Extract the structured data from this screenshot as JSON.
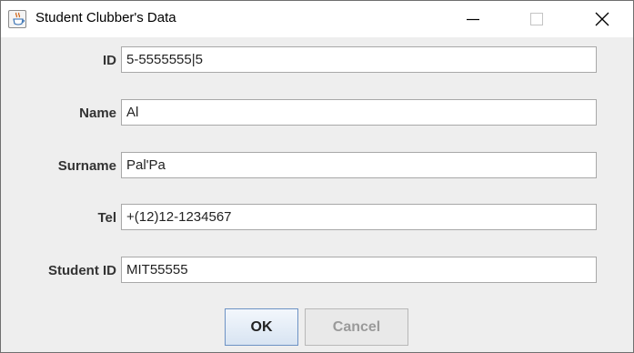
{
  "window": {
    "title": "Student Clubber's Data",
    "icons": {
      "app": "java-coffee-cup-icon",
      "minimize": "minimize-icon",
      "maximize": "maximize-icon",
      "close": "close-icon"
    }
  },
  "form": {
    "fields": [
      {
        "label": "ID",
        "value": "5-5555555|5"
      },
      {
        "label": "Name",
        "value": "Al"
      },
      {
        "label": "Surname",
        "value": "Pal'Pa"
      },
      {
        "label": "Tel",
        "value": "+(12)12-1234567"
      },
      {
        "label": "Student ID",
        "value": "MIT55555"
      }
    ]
  },
  "buttons": {
    "ok_label": "OK",
    "cancel_label": "Cancel",
    "cancel_enabled": false
  },
  "colors": {
    "accent_border": "#6d92c4",
    "dialog_bg": "#eeeeee",
    "disabled_text": "#9a9a9a"
  }
}
